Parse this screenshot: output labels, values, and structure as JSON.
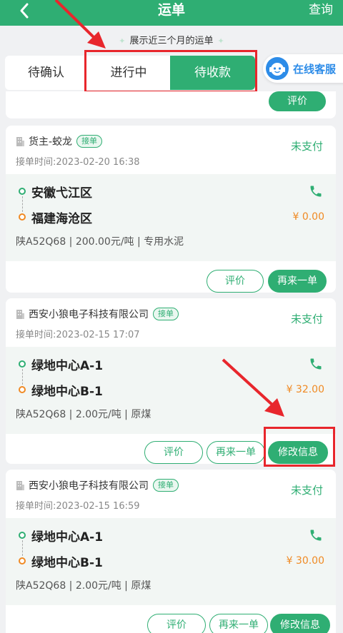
{
  "header": {
    "title": "运单",
    "query_label": "查询"
  },
  "hint": {
    "text": "展示近三个月的运单"
  },
  "tabs": [
    {
      "label": "待确认"
    },
    {
      "label": "进行中"
    },
    {
      "label": "待收款"
    }
  ],
  "service": {
    "label": "在线客服"
  },
  "partial_card": {
    "rate_label": "评价"
  },
  "orders": [
    {
      "company": "货主-蛟龙",
      "badge": "接单",
      "time": "接单时间:2023-02-20 16:38",
      "status": "未支付",
      "from": "安徽弋江区",
      "to": "福建海沧区",
      "price": "¥ 0.00",
      "info": "陕A52Q68 | 200.00元/吨 | 专用水泥",
      "actions": [
        "评价",
        "再来一单"
      ]
    },
    {
      "company": "西安小狼电子科技有限公司",
      "badge": "接单",
      "time": "接单时间:2023-02-15 17:07",
      "status": "未支付",
      "from": "绿地中心A-1",
      "to": "绿地中心B-1",
      "price": "¥ 32.00",
      "info": "陕A52Q68 | 2.00元/吨 | 原煤",
      "actions": [
        "评价",
        "再来一单",
        "修改信息"
      ]
    },
    {
      "company": "西安小狼电子科技有限公司",
      "badge": "接单",
      "time": "接单时间:2023-02-15 16:59",
      "status": "未支付",
      "from": "绿地中心A-1",
      "to": "绿地中心B-1",
      "price": "¥ 30.00",
      "info": "陕A52Q68 | 2.00元/吨 | 原煤",
      "actions": [
        "评价",
        "再来一单",
        "修改信息"
      ]
    }
  ],
  "icons": {
    "back": "chevron-left-icon",
    "building": "building-icon",
    "phone": "phone-icon",
    "service": "customer-service-icon"
  },
  "colors": {
    "primary": "#2fae73",
    "orange": "#f08a24",
    "annotation_red": "#e8262c",
    "service_blue": "#2d8ce8"
  }
}
